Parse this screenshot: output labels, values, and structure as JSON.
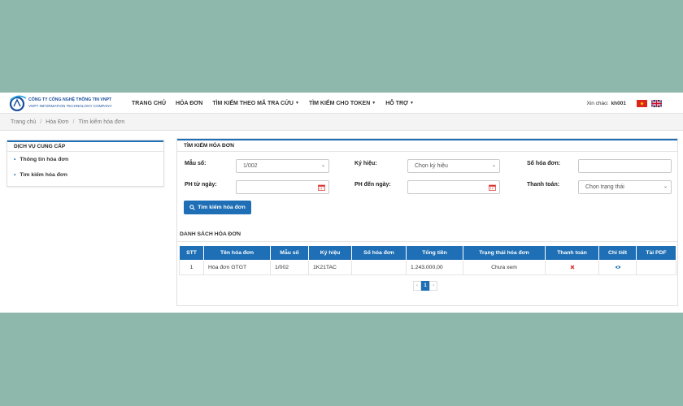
{
  "brand": {
    "line1": "CÔNG TY CÔNG NGHỆ THÔNG TIN VNPT",
    "line2": "VNPT INFORMATION TECHNOLOGY COMPANY",
    "color": "#1a4f9c"
  },
  "nav": {
    "items": [
      {
        "label": "TRANG CHỦ",
        "has_caret": false
      },
      {
        "label": "HÓA ĐƠN",
        "has_caret": false
      },
      {
        "label": "TÌM KIẾM THEO MÃ TRA CỨU",
        "has_caret": true
      },
      {
        "label": "TÌM KIẾM CHO TOKEN",
        "has_caret": true
      },
      {
        "label": "HỖ TRỢ",
        "has_caret": true
      }
    ],
    "greeting": "Xin chào:",
    "username": "kh001",
    "languages": [
      "vn-flag-icon",
      "uk-flag-icon"
    ]
  },
  "breadcrumb": [
    "Trang chủ",
    "Hóa Đơn",
    "Tìm kiếm hóa đơn"
  ],
  "sidebar": {
    "title": "DỊCH VỤ CUNG CẤP",
    "items": [
      {
        "label": "Thông tin hóa đơn"
      },
      {
        "label": "Tìm kiếm hóa đơn"
      }
    ]
  },
  "search": {
    "title": "TÌM KIẾM HÓA ĐƠN",
    "mau_so_label": "Mẫu số:",
    "mau_so_value": "1/002",
    "ky_hieu_label": "Ký hiệu:",
    "ky_hieu_value": "Chọn ký hiệu",
    "so_hoa_don_label": "Số hóa đơn:",
    "so_hoa_don_value": "",
    "ph_tu_ngay_label": "PH từ ngày:",
    "ph_den_ngay_label": "PH đến ngày:",
    "thanh_toan_label": "Thanh toán:",
    "thanh_toan_value": "Chọn trạng thái",
    "button_label": "Tìm kiếm hóa đơn"
  },
  "list": {
    "title": "DANH SÁCH HÓA ĐƠN",
    "columns": [
      "STT",
      "Tên hóa đơn",
      "Mẫu số",
      "Ký hiệu",
      "Số hóa đơn",
      "Tổng tiền",
      "Trạng thái hóa đơn",
      "Thanh toán",
      "Chi tiết",
      "Tải PDF"
    ],
    "rows": [
      {
        "stt": "1",
        "ten": "Hóa đơn GTGT",
        "mau_so": "1/002",
        "ky_hieu": "1K21TAC",
        "so_hd": "",
        "tong_tien": "1.243.000,00",
        "trang_thai": "Chưa xem",
        "thanh_toan_icon": "x-icon",
        "chi_tiet_icon": "eye-icon"
      }
    ],
    "pagination": {
      "prev": "‹",
      "current": "1",
      "next": "›"
    }
  },
  "colors": {
    "accent": "#1e6fb5",
    "background": "#8db8ab",
    "error": "#d9322d"
  }
}
